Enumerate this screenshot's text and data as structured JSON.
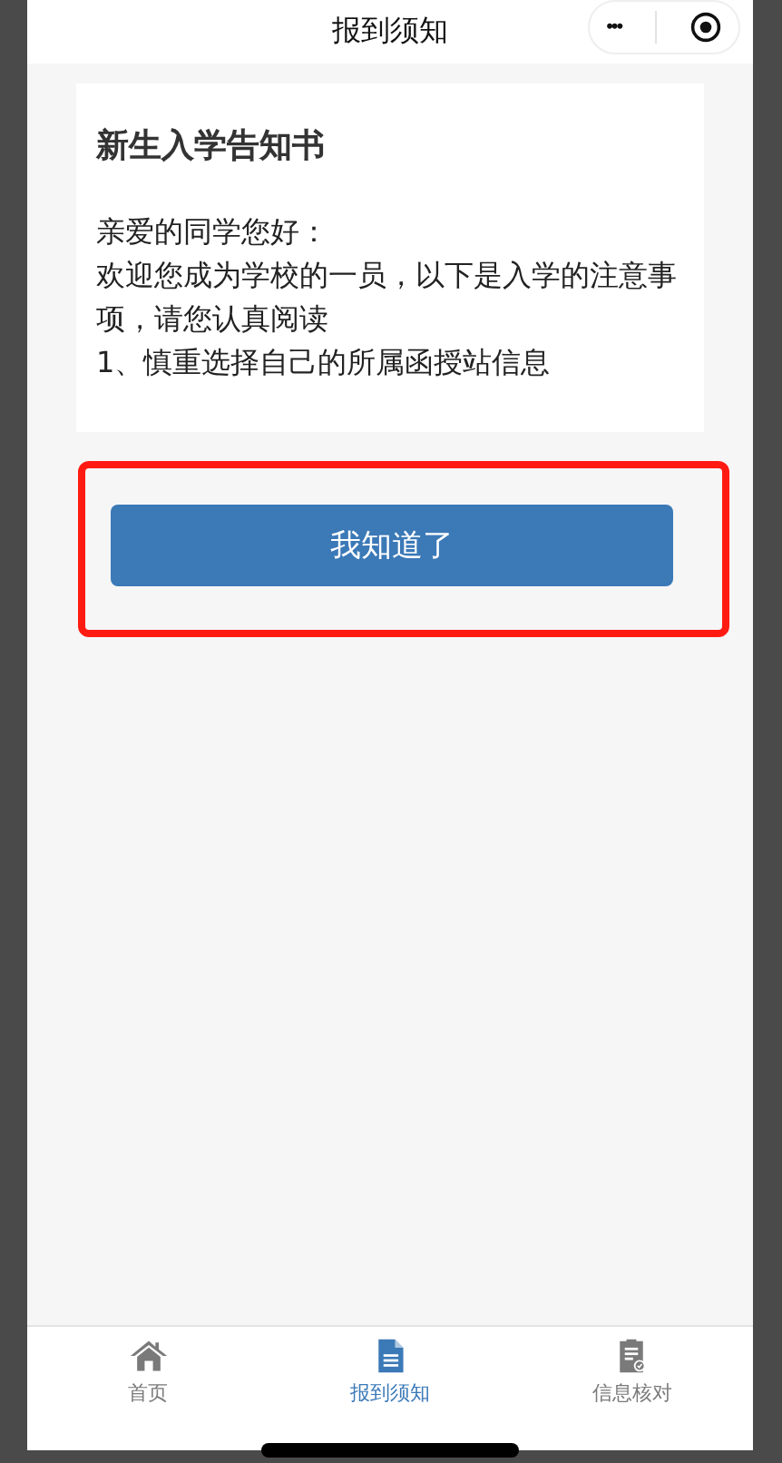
{
  "nav_bar": {
    "title": "报到须知",
    "menu_icon": "•••"
  },
  "notice": {
    "title": "新生入学告知书",
    "paragraphs": [
      "亲爱的同学您好：",
      "欢迎您成为学校的一员，以下是入学的注意事项，请您认真阅读",
      "1、慎重选择自己的所属函授站信息"
    ]
  },
  "confirm_button": {
    "label": "我知道了",
    "highlighted": true
  },
  "tab_bar": [
    {
      "label": "首页",
      "kind": "home",
      "selected": false
    },
    {
      "label": "报到须知",
      "kind": "notice",
      "selected": true
    },
    {
      "label": "信息核对",
      "kind": "check",
      "selected": false
    }
  ]
}
